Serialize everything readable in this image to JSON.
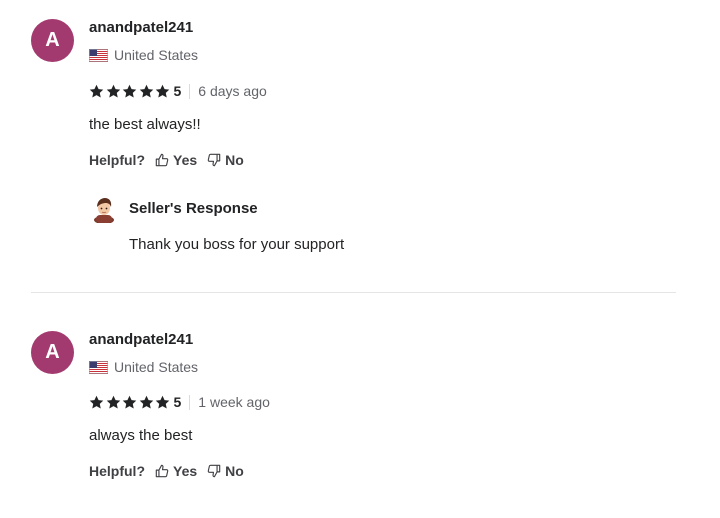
{
  "colors": {
    "avatar_bg": "#a23a6f",
    "star": "#222325",
    "divider": "#e4e5e7"
  },
  "reviews": [
    {
      "avatar_letter": "A",
      "username": "anandpatel241",
      "country": "United States",
      "flag_icon": "us-flag-icon",
      "rating": 5,
      "score": "5",
      "time": "6 days ago",
      "comment": "the best always!!",
      "helpful_label": "Helpful?",
      "yes_label": "Yes",
      "no_label": "No",
      "seller_response": {
        "title": "Seller's Response",
        "text": "Thank you boss for your support"
      }
    },
    {
      "avatar_letter": "A",
      "username": "anandpatel241",
      "country": "United States",
      "flag_icon": "us-flag-icon",
      "rating": 5,
      "score": "5",
      "time": "1 week ago",
      "comment": "always the best",
      "helpful_label": "Helpful?",
      "yes_label": "Yes",
      "no_label": "No"
    }
  ]
}
